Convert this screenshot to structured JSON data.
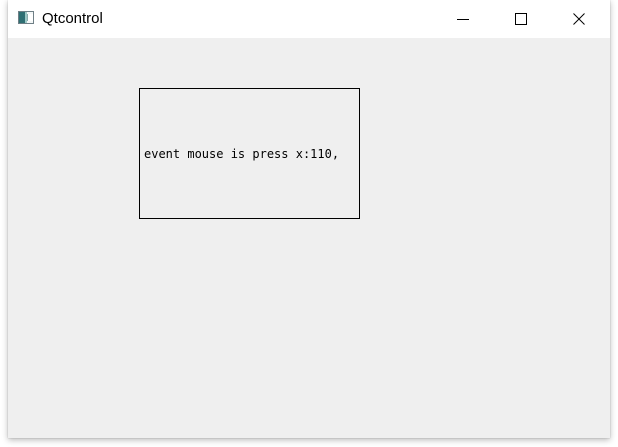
{
  "window": {
    "title": "Qtcontrol",
    "app_icon": "qt-window-icon",
    "controls": {
      "minimize_icon": "minimize-icon",
      "maximize_icon": "maximize-icon",
      "close_icon": "close-icon"
    }
  },
  "content": {
    "event_label": "event mouse is press x:110,"
  },
  "colors": {
    "titlebar": "#ffffff",
    "client_background": "#efefef",
    "text": "#000000",
    "border": "#000000"
  }
}
